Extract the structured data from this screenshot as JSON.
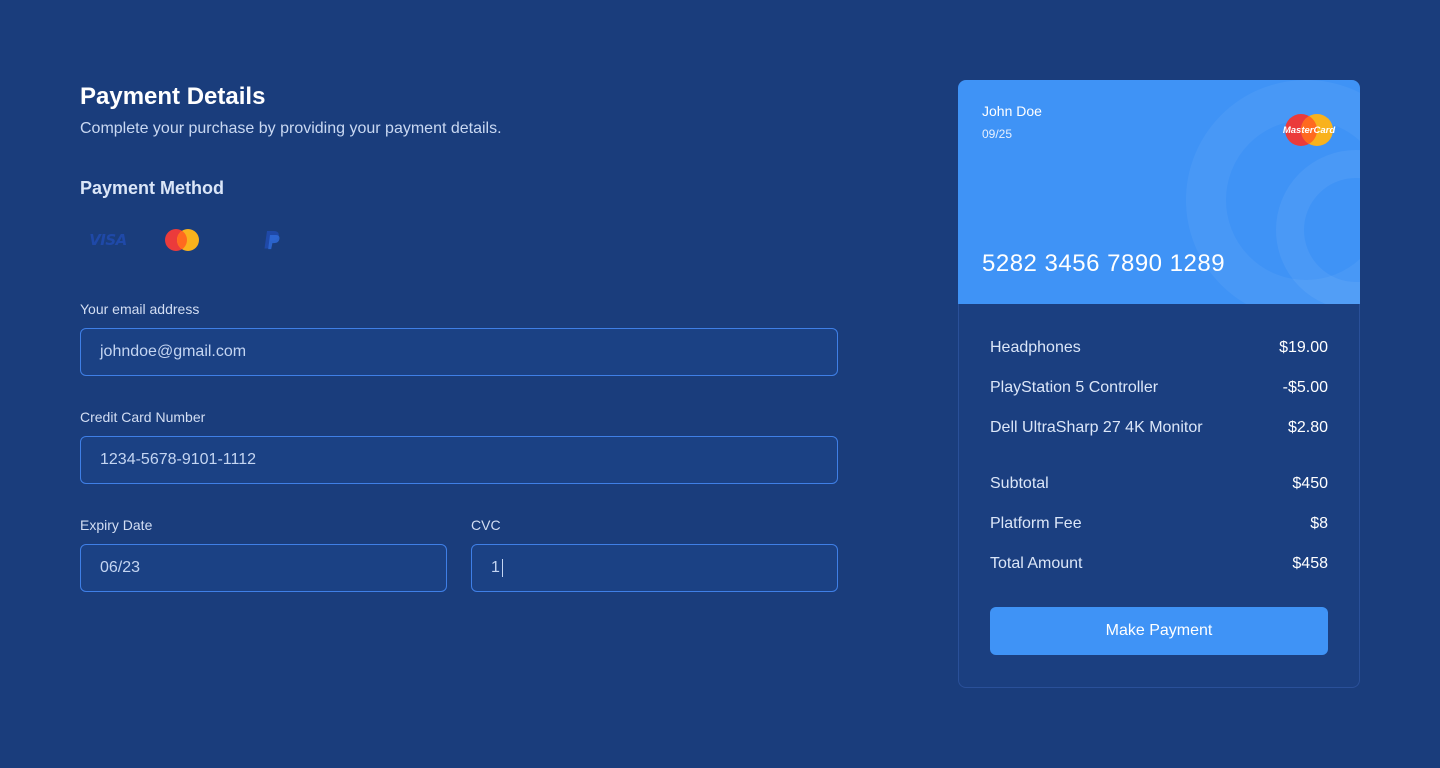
{
  "form": {
    "title": "Payment Details",
    "subtitle": "Complete your purchase by providing your payment details.",
    "method_title": "Payment Method",
    "methods": [
      {
        "label": "VISA",
        "icon": "visa-icon"
      },
      {
        "label": "",
        "icon": "mastercard-icon"
      },
      {
        "label": "",
        "icon": "paypal-icon"
      }
    ],
    "email": {
      "label": "Your email address",
      "value": "johndoe@gmail.com"
    },
    "card_number": {
      "label": "Credit Card Number",
      "value": "1234-5678-9101-1112"
    },
    "expiry": {
      "label": "Expiry Date",
      "value": "06/23"
    },
    "cvc": {
      "label": "CVC",
      "value": "1"
    }
  },
  "card": {
    "name": "John Doe",
    "expiry": "09/25",
    "brand_label": "MasterCard",
    "number": "5282 3456 7890 1289"
  },
  "summary": {
    "items": [
      {
        "name": "Headphones",
        "amount": "$19.00"
      },
      {
        "name": "PlayStation 5 Controller",
        "amount": "-$5.00"
      },
      {
        "name": "Dell UltraSharp 27 4K Monitor",
        "amount": "$2.80"
      }
    ],
    "subtotal": {
      "label": "Subtotal",
      "amount": "$450"
    },
    "fee": {
      "label": "Platform Fee",
      "amount": "$8"
    },
    "total": {
      "label": "Total Amount",
      "amount": "$458"
    },
    "pay_button": "Make Payment"
  },
  "colors": {
    "background": "#1a3d7c",
    "accent": "#3f93f6",
    "input_border": "#3f7fe6"
  }
}
